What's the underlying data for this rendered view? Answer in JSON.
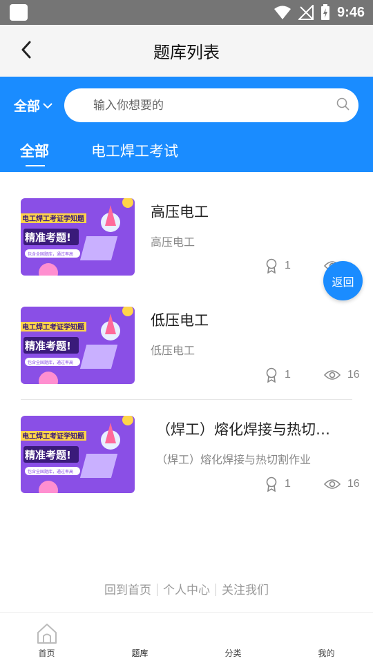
{
  "status_bar": {
    "time": "9:46"
  },
  "header": {
    "title": "题库列表"
  },
  "filter": {
    "label": "全部"
  },
  "search": {
    "placeholder": "输入你想要的"
  },
  "tabs": [
    {
      "label": "全部",
      "active": true
    },
    {
      "label": "电工焊工考试",
      "active": false
    }
  ],
  "thumb": {
    "banner_text": "电工焊工考证学知题",
    "headline": "精准考题!",
    "note": "包含全国题库，通过率高"
  },
  "items": [
    {
      "title": "高压电工",
      "subtitle": "高压电工",
      "likes": "1",
      "views": ""
    },
    {
      "title": "低压电工",
      "subtitle": "低压电工",
      "likes": "1",
      "views": "16"
    },
    {
      "title": "（焊工）熔化焊接与热切…",
      "subtitle": "（焊工）熔化焊接与热切割作业",
      "likes": "1",
      "views": "16"
    }
  ],
  "float_button": {
    "label": "返回"
  },
  "footer_links": [
    "回到首页",
    "个人中心",
    "关注我们"
  ],
  "bottom_nav": [
    {
      "label": "首页",
      "icon": "home-icon"
    },
    {
      "label": "题库",
      "icon": ""
    },
    {
      "label": "分类",
      "icon": ""
    },
    {
      "label": "我的",
      "icon": ""
    }
  ],
  "colors": {
    "primary": "#1a8cff",
    "status_bar": "#757575",
    "thumb_bg": "#8a4fe6"
  }
}
